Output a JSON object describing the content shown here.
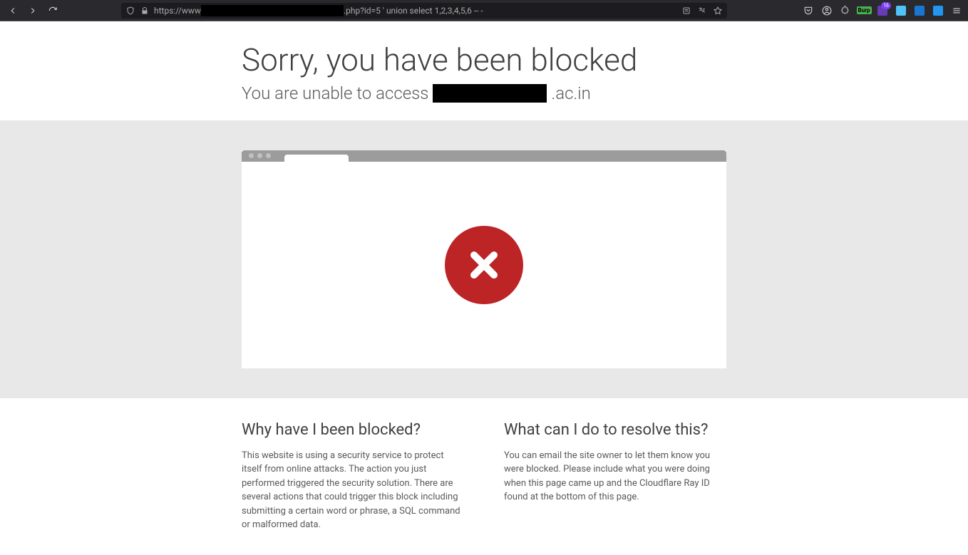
{
  "browser": {
    "url_prefix": "https://www",
    "url_suffix": ".php?id=5 ' union select 1,2,3,4,5,6 -- -",
    "notif_count": "16",
    "ext_label": "Burp"
  },
  "page": {
    "title": "Sorry, you have been blocked",
    "subtitle_prefix": "You are unable to access",
    "subtitle_suffix": ".ac.in"
  },
  "info": {
    "left": {
      "heading": "Why have I been blocked?",
      "body": "This website is using a security service to protect itself from online attacks. The action you just performed triggered the security solution. There are several actions that could trigger this block including submitting a certain word or phrase, a SQL command or malformed data."
    },
    "right": {
      "heading": "What can I do to resolve this?",
      "body": "You can email the site owner to let them know you were blocked. Please include what you were doing when this page came up and the Cloudflare Ray ID found at the bottom of this page."
    }
  }
}
